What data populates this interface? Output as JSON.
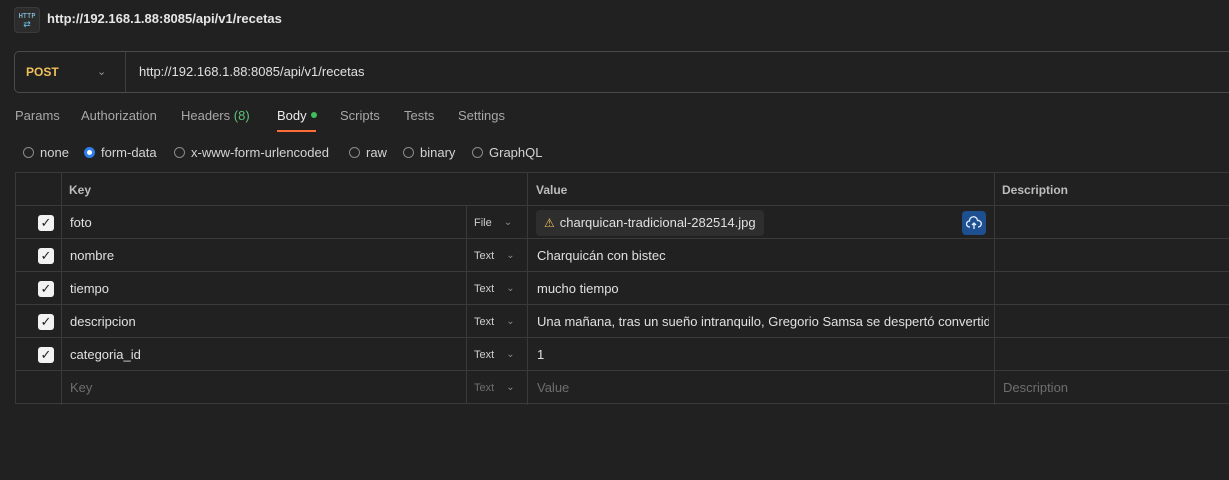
{
  "title": "http://192.168.1.88:8085/api/v1/recetas",
  "icons": {
    "app": "http-icon",
    "upload": "cloud-upload-icon",
    "warning": "warning-icon",
    "check": "check-icon",
    "chevron": "chevron-down-icon"
  },
  "colors": {
    "method": "#f0c15a",
    "accent": "#ff6c37",
    "active_dot": "#3fbf5c",
    "radio_on": "#2e7de9",
    "upload_button": "#1d4f91"
  },
  "request": {
    "method": "POST",
    "url": "http://192.168.1.88:8085/api/v1/recetas"
  },
  "tabs": [
    {
      "label": "Params"
    },
    {
      "label": "Authorization"
    },
    {
      "label": "Headers",
      "count": "(8)"
    },
    {
      "label": "Body",
      "active": true
    },
    {
      "label": "Scripts"
    },
    {
      "label": "Tests"
    },
    {
      "label": "Settings"
    }
  ],
  "body_types": [
    {
      "label": "none",
      "selected": false
    },
    {
      "label": "form-data",
      "selected": true
    },
    {
      "label": "x-www-form-urlencoded",
      "selected": false
    },
    {
      "label": "raw",
      "selected": false
    },
    {
      "label": "binary",
      "selected": false
    },
    {
      "label": "GraphQL",
      "selected": false
    }
  ],
  "table": {
    "headers": {
      "key": "Key",
      "value": "Value",
      "description": "Description"
    },
    "rows": [
      {
        "checked": true,
        "key": "foto",
        "type": "File",
        "value": "charquican-tradicional-282514.jpg",
        "description": ""
      },
      {
        "checked": true,
        "key": "nombre",
        "type": "Text",
        "value": "Charquicán con bistec",
        "description": ""
      },
      {
        "checked": true,
        "key": "tiempo",
        "type": "Text",
        "value": "mucho tiempo",
        "description": ""
      },
      {
        "checked": true,
        "key": "descripcion",
        "type": "Text",
        "value": "Una mañana, tras un sueño intranquilo, Gregorio Samsa se despertó convertid…",
        "description": ""
      },
      {
        "checked": true,
        "key": "categoria_id",
        "type": "Text",
        "value": "1",
        "description": ""
      }
    ],
    "new_row": {
      "key_placeholder": "Key",
      "type": "Text",
      "value_placeholder": "Value",
      "description_placeholder": "Description"
    }
  }
}
